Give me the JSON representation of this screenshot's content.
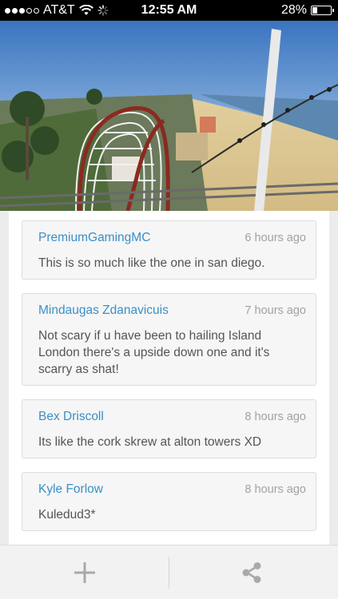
{
  "status_bar": {
    "carrier": "AT&T",
    "time": "12:55 AM",
    "battery_percent": "28%",
    "battery_level": 0.28,
    "signal_bars_filled": 3,
    "signal_bars_total": 5
  },
  "media": {
    "description_icon": "roller-coaster-photo"
  },
  "comments": [
    {
      "author": "PremiumGamingMC",
      "time": "6 hours ago",
      "text": "This is so much like the one in san diego."
    },
    {
      "author": "Mindaugas Zdanavicuis",
      "time": "7 hours ago",
      "text": "Not scary if u have been to hailing Island London there's a upside down one and it's scarry as shat!"
    },
    {
      "author": "Bex Driscoll",
      "time": "8 hours ago",
      "text": "Its like the cork skrew at alton towers XD"
    },
    {
      "author": "Kyle Forlow",
      "time": "8 hours ago",
      "text": "Kuledud3*"
    }
  ],
  "toolbar": {
    "add_icon": "plus-icon",
    "share_icon": "share-icon"
  },
  "colors": {
    "author": "#3a8fc7",
    "timestamp": "#a2a2a2",
    "body_text": "#555555",
    "toolbar_icon": "#a9a9a9"
  }
}
